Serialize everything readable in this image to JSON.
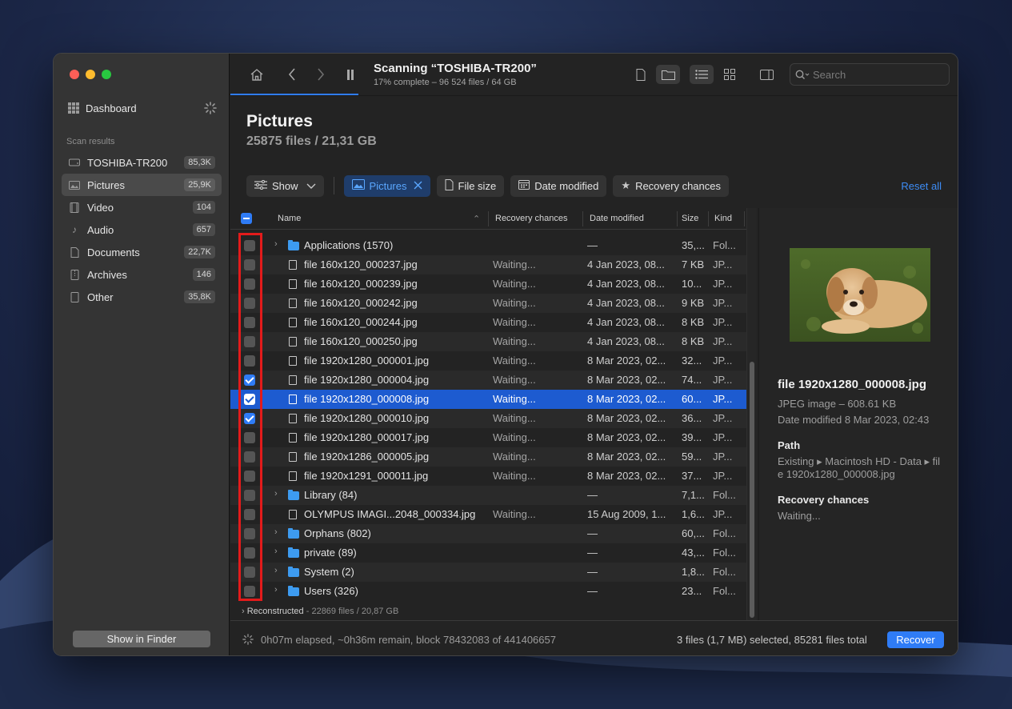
{
  "colors": {
    "accent": "#2f7cf6",
    "selected_row": "#1d5bd0",
    "annotation": "#e31b1b",
    "folder": "#3d9bf0"
  },
  "sidebar": {
    "dashboard_label": "Dashboard",
    "section_label": "Scan results",
    "items": [
      {
        "label": "TOSHIBA-TR200",
        "count": "85,3K",
        "icon": "drive-icon"
      },
      {
        "label": "Pictures",
        "count": "25,9K",
        "icon": "picture-icon"
      },
      {
        "label": "Video",
        "count": "104",
        "icon": "film-icon"
      },
      {
        "label": "Audio",
        "count": "657",
        "icon": "music-note-icon"
      },
      {
        "label": "Documents",
        "count": "22,7K",
        "icon": "document-icon"
      },
      {
        "label": "Archives",
        "count": "146",
        "icon": "archive-icon"
      },
      {
        "label": "Other",
        "count": "35,8K",
        "icon": "file-icon"
      }
    ],
    "show_in_finder": "Show in Finder"
  },
  "toolbar": {
    "title": "Scanning “TOSHIBA-TR200”",
    "subtitle": "17% complete – 96 524 files / 64 GB",
    "search_placeholder": "Search"
  },
  "page": {
    "title": "Pictures",
    "subtitle": "25875 files / 21,31 GB"
  },
  "filters": {
    "show": "Show",
    "pictures": "Pictures",
    "file_size": "File size",
    "date_modified": "Date modified",
    "recovery_chances": "Recovery chances",
    "reset_all": "Reset all"
  },
  "table": {
    "headers": {
      "name": "Name",
      "recovery": "Recovery chances",
      "date": "Date modified",
      "size": "Size",
      "kind": "Kind"
    },
    "rows": [
      {
        "type": "folder",
        "checked": false,
        "selected": false,
        "name": "Applications (1570)",
        "recovery": "",
        "date": "—",
        "size": "35,...",
        "kind": "Fol..."
      },
      {
        "type": "file",
        "checked": false,
        "selected": false,
        "name": "file 160x120_000237.jpg",
        "recovery": "Waiting...",
        "date": "4 Jan 2023, 08...",
        "size": "7 KB",
        "kind": "JP..."
      },
      {
        "type": "file",
        "checked": false,
        "selected": false,
        "name": "file 160x120_000239.jpg",
        "recovery": "Waiting...",
        "date": "4 Jan 2023, 08...",
        "size": "10...",
        "kind": "JP..."
      },
      {
        "type": "file",
        "checked": false,
        "selected": false,
        "name": "file 160x120_000242.jpg",
        "recovery": "Waiting...",
        "date": "4 Jan 2023, 08...",
        "size": "9 KB",
        "kind": "JP..."
      },
      {
        "type": "file",
        "checked": false,
        "selected": false,
        "name": "file 160x120_000244.jpg",
        "recovery": "Waiting...",
        "date": "4 Jan 2023, 08...",
        "size": "8 KB",
        "kind": "JP..."
      },
      {
        "type": "file",
        "checked": false,
        "selected": false,
        "name": "file 160x120_000250.jpg",
        "recovery": "Waiting...",
        "date": "4 Jan 2023, 08...",
        "size": "8 KB",
        "kind": "JP..."
      },
      {
        "type": "file",
        "checked": false,
        "selected": false,
        "name": "file 1920x1280_000001.jpg",
        "recovery": "Waiting...",
        "date": "8 Mar 2023, 02...",
        "size": "32...",
        "kind": "JP..."
      },
      {
        "type": "file",
        "checked": true,
        "selected": false,
        "name": "file 1920x1280_000004.jpg",
        "recovery": "Waiting...",
        "date": "8 Mar 2023, 02...",
        "size": "74...",
        "kind": "JP..."
      },
      {
        "type": "file",
        "checked": true,
        "selected": true,
        "name": "file 1920x1280_000008.jpg",
        "recovery": "Waiting...",
        "date": "8 Mar 2023, 02...",
        "size": "60...",
        "kind": "JP..."
      },
      {
        "type": "file",
        "checked": true,
        "selected": false,
        "name": "file 1920x1280_000010.jpg",
        "recovery": "Waiting...",
        "date": "8 Mar 2023, 02...",
        "size": "36...",
        "kind": "JP..."
      },
      {
        "type": "file",
        "checked": false,
        "selected": false,
        "name": "file 1920x1280_000017.jpg",
        "recovery": "Waiting...",
        "date": "8 Mar 2023, 02...",
        "size": "39...",
        "kind": "JP..."
      },
      {
        "type": "file",
        "checked": false,
        "selected": false,
        "name": "file 1920x1286_000005.jpg",
        "recovery": "Waiting...",
        "date": "8 Mar 2023, 02...",
        "size": "59...",
        "kind": "JP..."
      },
      {
        "type": "file",
        "checked": false,
        "selected": false,
        "name": "file 1920x1291_000011.jpg",
        "recovery": "Waiting...",
        "date": "8 Mar 2023, 02...",
        "size": "37...",
        "kind": "JP..."
      },
      {
        "type": "folder",
        "checked": false,
        "selected": false,
        "name": "Library (84)",
        "recovery": "",
        "date": "—",
        "size": "7,1...",
        "kind": "Fol..."
      },
      {
        "type": "file",
        "checked": false,
        "selected": false,
        "name": "OLYMPUS IMAGI...2048_000334.jpg",
        "recovery": "Waiting...",
        "date": "15 Aug 2009, 1...",
        "size": "1,6...",
        "kind": "JP..."
      },
      {
        "type": "folder",
        "checked": false,
        "selected": false,
        "name": "Orphans (802)",
        "recovery": "",
        "date": "—",
        "size": "60,...",
        "kind": "Fol..."
      },
      {
        "type": "folder",
        "checked": false,
        "selected": false,
        "name": "private (89)",
        "recovery": "",
        "date": "—",
        "size": "43,...",
        "kind": "Fol..."
      },
      {
        "type": "folder",
        "checked": false,
        "selected": false,
        "name": "System (2)",
        "recovery": "",
        "date": "—",
        "size": "1,8...",
        "kind": "Fol..."
      },
      {
        "type": "folder",
        "checked": false,
        "selected": false,
        "name": "Users (326)",
        "recovery": "",
        "date": "—",
        "size": "23...",
        "kind": "Fol..."
      }
    ],
    "reconstructed_label": "Reconstructed",
    "reconstructed_stats": "- 22869 files / 20,87 GB"
  },
  "preview": {
    "name": "file 1920x1280_000008.jpg",
    "kind": "JPEG image – 608.61 KB",
    "date": "Date modified  8 Mar 2023, 02:43",
    "path_label": "Path",
    "path_line1": "Existing ▸ Macintosh HD - Data ▸ fil",
    "path_line2": "e 1920x1280_000008.jpg",
    "recovery_label": "Recovery chances",
    "recovery_value": "Waiting..."
  },
  "status": {
    "elapsed": "0h07m elapsed, ~0h36m remain, block 78432083 of 441406657",
    "selection": "3 files (1,7 MB) selected, 85281 files total",
    "recover": "Recover"
  }
}
